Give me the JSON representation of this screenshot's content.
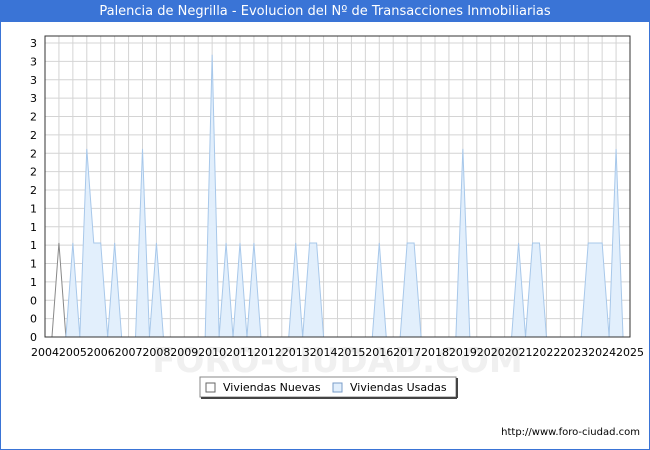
{
  "chart_data": {
    "type": "area",
    "title": "Palencia de Negrilla - Evolucion del Nº de Transacciones Inmobiliarias",
    "xlabel": "",
    "ylabel": "",
    "x_tick_labels": [
      "2004",
      "2005",
      "2006",
      "2007",
      "2008",
      "2009",
      "2010",
      "2011",
      "2012",
      "2013",
      "2014",
      "2015",
      "2016",
      "2017",
      "2018",
      "2019",
      "2020",
      "2021",
      "2022",
      "2023",
      "2024",
      "2025"
    ],
    "y_tick_labels": [
      "0",
      "0",
      "0",
      "1",
      "1",
      "1",
      "1",
      "1",
      "2",
      "2",
      "2",
      "2",
      "2",
      "3",
      "3",
      "3",
      "3"
    ],
    "ylim": [
      0,
      3.2
    ],
    "xlim": [
      2004,
      2025
    ],
    "grid": true,
    "legend_position": "bottom",
    "series": [
      {
        "name": "Viviendas Nuevas",
        "color": "#888888",
        "fill": "#ffffff",
        "points": [
          [
            2004.25,
            0
          ],
          [
            2004.5,
            1
          ],
          [
            2004.75,
            0
          ]
        ]
      },
      {
        "name": "Viviendas Usadas",
        "color": "#a8c8ea",
        "fill": "#e2effc",
        "points": [
          [
            2004.75,
            0
          ],
          [
            2005.0,
            1
          ],
          [
            2005.25,
            0
          ],
          [
            2005.25,
            0
          ],
          [
            2005.5,
            2
          ],
          [
            2005.75,
            1
          ],
          [
            2006.0,
            1
          ],
          [
            2006.25,
            0
          ],
          [
            2006.25,
            0
          ],
          [
            2006.5,
            1
          ],
          [
            2006.75,
            0
          ],
          [
            2007.25,
            0
          ],
          [
            2007.5,
            2
          ],
          [
            2007.75,
            0
          ],
          [
            2008.0,
            1
          ],
          [
            2008.25,
            0
          ],
          [
            2009.75,
            0
          ],
          [
            2010.0,
            3
          ],
          [
            2010.25,
            0
          ],
          [
            2010.5,
            1
          ],
          [
            2010.75,
            0
          ],
          [
            2011.0,
            1
          ],
          [
            2011.25,
            0
          ],
          [
            2011.25,
            0
          ],
          [
            2011.5,
            1
          ],
          [
            2011.75,
            0
          ],
          [
            2012.75,
            0
          ],
          [
            2013.0,
            1
          ],
          [
            2013.25,
            0
          ],
          [
            2013.5,
            1
          ],
          [
            2013.75,
            1
          ],
          [
            2014.0,
            0
          ],
          [
            2015.75,
            0
          ],
          [
            2016.0,
            1
          ],
          [
            2016.25,
            0
          ],
          [
            2016.75,
            0
          ],
          [
            2017.0,
            1
          ],
          [
            2017.25,
            1
          ],
          [
            2017.5,
            0
          ],
          [
            2018.75,
            0
          ],
          [
            2019.0,
            2
          ],
          [
            2019.25,
            0
          ],
          [
            2020.75,
            0
          ],
          [
            2021.0,
            1
          ],
          [
            2021.25,
            0
          ],
          [
            2021.5,
            1
          ],
          [
            2021.75,
            1
          ],
          [
            2022.0,
            0
          ],
          [
            2023.25,
            0
          ],
          [
            2023.5,
            1
          ],
          [
            2023.75,
            1
          ],
          [
            2024.0,
            1
          ],
          [
            2024.25,
            0
          ],
          [
            2024.25,
            0
          ],
          [
            2024.5,
            2
          ],
          [
            2024.75,
            0
          ]
        ]
      }
    ]
  },
  "footer": {
    "url": "http://www.foro-ciudad.com"
  },
  "watermark": "FORO-CIUDAD.COM"
}
